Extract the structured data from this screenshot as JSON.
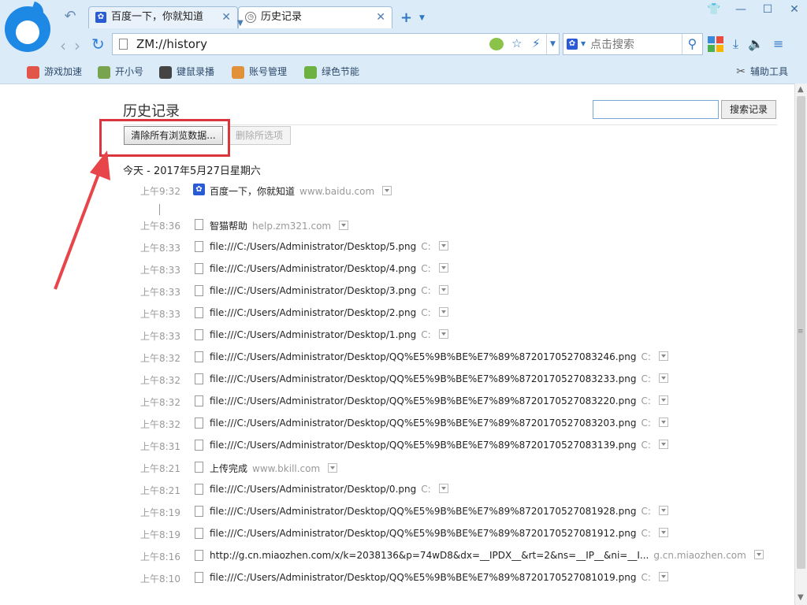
{
  "colors": {
    "accent": "#2f76c4",
    "highlight": "#d9363e",
    "chrome": "#dcebf8"
  },
  "tabs": [
    {
      "label": "百度一下，你就知道",
      "icon": "baidu-paw-icon"
    },
    {
      "label": "历史记录",
      "icon": "clock-icon"
    }
  ],
  "address": {
    "url": "ZM://history"
  },
  "search": {
    "placeholder": "点击搜索"
  },
  "bookmarks": [
    {
      "label": "游戏加速",
      "color": "#e2554b"
    },
    {
      "label": "开小号",
      "color": "#7aa34d"
    },
    {
      "label": "键鼠录播",
      "color": "#444444"
    },
    {
      "label": "账号管理",
      "color": "#e0913a"
    },
    {
      "label": "绿色节能",
      "color": "#6bb243"
    }
  ],
  "helper_tools": "辅助工具",
  "history": {
    "title": "历史记录",
    "search_button": "搜索记录",
    "clear_button": "清除所有浏览数据...",
    "delete_button": "删除所选项",
    "day": "今天 - 2017年5月27日星期六",
    "entries": [
      {
        "time": "上午9:32",
        "title": "百度一下，你就知道",
        "host": "www.baidu.com",
        "icon": "baidu-paw-icon"
      },
      {
        "time": "上午8:36",
        "title": "智猫帮助",
        "host": "help.zm321.com",
        "icon": "page-icon"
      },
      {
        "time": "上午8:33",
        "title": "file:///C:/Users/Administrator/Desktop/5.png",
        "host": "C:",
        "icon": "page-icon"
      },
      {
        "time": "上午8:33",
        "title": "file:///C:/Users/Administrator/Desktop/4.png",
        "host": "C:",
        "icon": "page-icon"
      },
      {
        "time": "上午8:33",
        "title": "file:///C:/Users/Administrator/Desktop/3.png",
        "host": "C:",
        "icon": "page-icon"
      },
      {
        "time": "上午8:33",
        "title": "file:///C:/Users/Administrator/Desktop/2.png",
        "host": "C:",
        "icon": "page-icon"
      },
      {
        "time": "上午8:33",
        "title": "file:///C:/Users/Administrator/Desktop/1.png",
        "host": "C:",
        "icon": "page-icon"
      },
      {
        "time": "上午8:32",
        "title": "file:///C:/Users/Administrator/Desktop/QQ%E5%9B%BE%E7%89%8720170527083246.png",
        "host": "C:",
        "icon": "page-icon"
      },
      {
        "time": "上午8:32",
        "title": "file:///C:/Users/Administrator/Desktop/QQ%E5%9B%BE%E7%89%8720170527083233.png",
        "host": "C:",
        "icon": "page-icon"
      },
      {
        "time": "上午8:32",
        "title": "file:///C:/Users/Administrator/Desktop/QQ%E5%9B%BE%E7%89%8720170527083220.png",
        "host": "C:",
        "icon": "page-icon"
      },
      {
        "time": "上午8:32",
        "title": "file:///C:/Users/Administrator/Desktop/QQ%E5%9B%BE%E7%89%8720170527083203.png",
        "host": "C:",
        "icon": "page-icon"
      },
      {
        "time": "上午8:31",
        "title": "file:///C:/Users/Administrator/Desktop/QQ%E5%9B%BE%E7%89%8720170527083139.png",
        "host": "C:",
        "icon": "page-icon"
      },
      {
        "time": "上午8:21",
        "title": "上传完成",
        "host": "www.bkill.com",
        "icon": "page-icon"
      },
      {
        "time": "上午8:21",
        "title": "file:///C:/Users/Administrator/Desktop/0.png",
        "host": "C:",
        "icon": "page-icon"
      },
      {
        "time": "上午8:19",
        "title": "file:///C:/Users/Administrator/Desktop/QQ%E5%9B%BE%E7%89%8720170527081928.png",
        "host": "C:",
        "icon": "page-icon"
      },
      {
        "time": "上午8:19",
        "title": "file:///C:/Users/Administrator/Desktop/QQ%E5%9B%BE%E7%89%8720170527081912.png",
        "host": "C:",
        "icon": "page-icon"
      },
      {
        "time": "上午8:16",
        "title": "http://g.cn.miaozhen.com/x/k=2038136&p=74wD8&dx=__IPDX__&rt=2&ns=__IP__&ni=__I...",
        "host": "g.cn.miaozhen.com",
        "icon": "page-icon"
      },
      {
        "time": "上午8:10",
        "title": "file:///C:/Users/Administrator/Desktop/QQ%E5%9B%BE%E7%89%8720170527081019.png",
        "host": "C:",
        "icon": "page-icon"
      }
    ]
  }
}
